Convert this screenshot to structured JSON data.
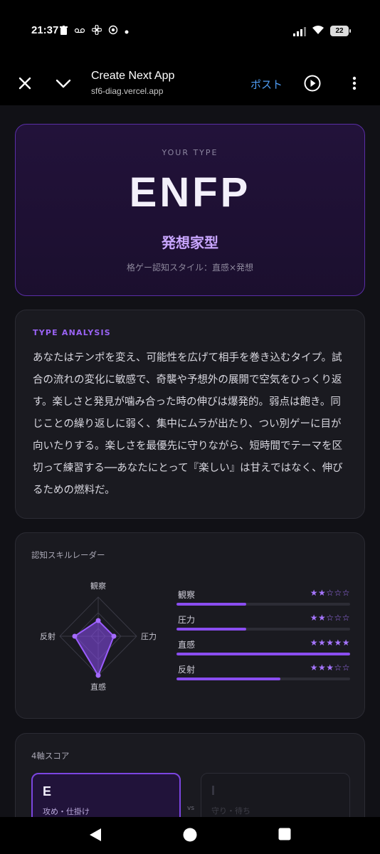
{
  "status_bar": {
    "time": "21:37",
    "battery": "22",
    "icons": [
      "trash-icon",
      "voicemail-icon",
      "fan-icon",
      "power-icon",
      "dot-icon"
    ]
  },
  "browser": {
    "title": "Create Next App",
    "url": "sf6-diag.vercel.app",
    "post_label": "ポスト"
  },
  "hero": {
    "kicker": "YOUR TYPE",
    "type": "ENFP",
    "name": "発想家型",
    "style": "格ゲー認知スタイル：直感×発想"
  },
  "analysis": {
    "label": "TYPE ANALYSIS",
    "text": "あなたはテンポを変え、可能性を広げて相手を巻き込むタイプ。試合の流れの変化に敏感で、奇襲や予想外の展開で空気をひっくり返す。楽しさと発見が噛み合った時の伸びは爆発的。弱点は飽き。同じことの繰り返しに弱く、集中にムラが出たり、つい別ゲーに目が向いたりする。楽しさを最優先に守りながら、短時間でテーマを区切って練習する──あなたにとって『楽しい』は甘えではなく、伸びるための燃料だ。"
  },
  "radar": {
    "title": "認知スキルレーダー",
    "labels": {
      "top": "観察",
      "right": "圧力",
      "bottom": "直感",
      "left": "反射"
    }
  },
  "skills": [
    {
      "name": "観察",
      "stars": "★★☆☆☆",
      "level": 0.4
    },
    {
      "name": "圧力",
      "stars": "★★☆☆☆",
      "level": 0.4
    },
    {
      "name": "直感",
      "stars": "★★★★★",
      "level": 1.0
    },
    {
      "name": "反射",
      "stars": "★★★☆☆",
      "level": 0.6
    }
  ],
  "axes": {
    "title": "4軸スコア",
    "left": {
      "letter": "E",
      "desc": "攻め・仕掛け"
    },
    "vs": "vs",
    "right": {
      "letter": "I",
      "desc": "守り・待ち"
    }
  },
  "colors": {
    "accent": "#8a4df0",
    "link": "#4f9df5",
    "background": "#111116"
  }
}
